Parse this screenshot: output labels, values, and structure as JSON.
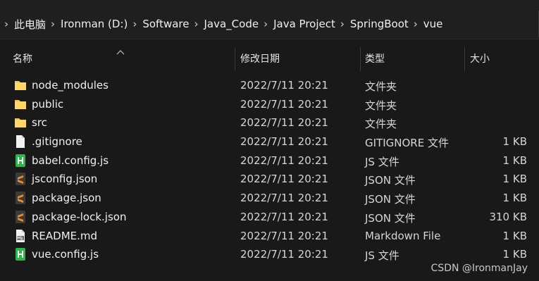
{
  "breadcrumb": {
    "items": [
      "此电脑",
      "Ironman (D:)",
      "Software",
      "Java_Code",
      "Java Project",
      "SpringBoot",
      "vue"
    ]
  },
  "columns": {
    "name": "名称",
    "date": "修改日期",
    "type": "类型",
    "size": "大小"
  },
  "files": [
    {
      "name": "node_modules",
      "date": "2022/7/11 20:21",
      "type": "文件夹",
      "size": "",
      "icon": "folder-icon"
    },
    {
      "name": "public",
      "date": "2022/7/11 20:21",
      "type": "文件夹",
      "size": "",
      "icon": "folder-icon"
    },
    {
      "name": "src",
      "date": "2022/7/11 20:21",
      "type": "文件夹",
      "size": "",
      "icon": "folder-icon"
    },
    {
      "name": ".gitignore",
      "date": "2022/7/11 20:21",
      "type": "GITIGNORE 文件",
      "size": "1 KB",
      "icon": "blank-file-icon"
    },
    {
      "name": "babel.config.js",
      "date": "2022/7/11 20:21",
      "type": "JS 文件",
      "size": "1 KB",
      "icon": "hbuilder-file-icon"
    },
    {
      "name": "jsconfig.json",
      "date": "2022/7/11 20:21",
      "type": "JSON 文件",
      "size": "1 KB",
      "icon": "sublime-file-icon"
    },
    {
      "name": "package.json",
      "date": "2022/7/11 20:21",
      "type": "JSON 文件",
      "size": "1 KB",
      "icon": "sublime-file-icon"
    },
    {
      "name": "package-lock.json",
      "date": "2022/7/11 20:21",
      "type": "JSON 文件",
      "size": "310 KB",
      "icon": "sublime-file-icon"
    },
    {
      "name": "README.md",
      "date": "2022/7/11 20:21",
      "type": "Markdown File",
      "size": "1 KB",
      "icon": "markdown-file-icon"
    },
    {
      "name": "vue.config.js",
      "date": "2022/7/11 20:21",
      "type": "JS 文件",
      "size": "1 KB",
      "icon": "hbuilder-file-icon"
    }
  ],
  "watermark": "CSDN @IronmanJay",
  "colors": {
    "background": "#191919",
    "folder": "#f4c04f",
    "hbuilder": "#2bb54a",
    "sublime": "#f08a24"
  }
}
